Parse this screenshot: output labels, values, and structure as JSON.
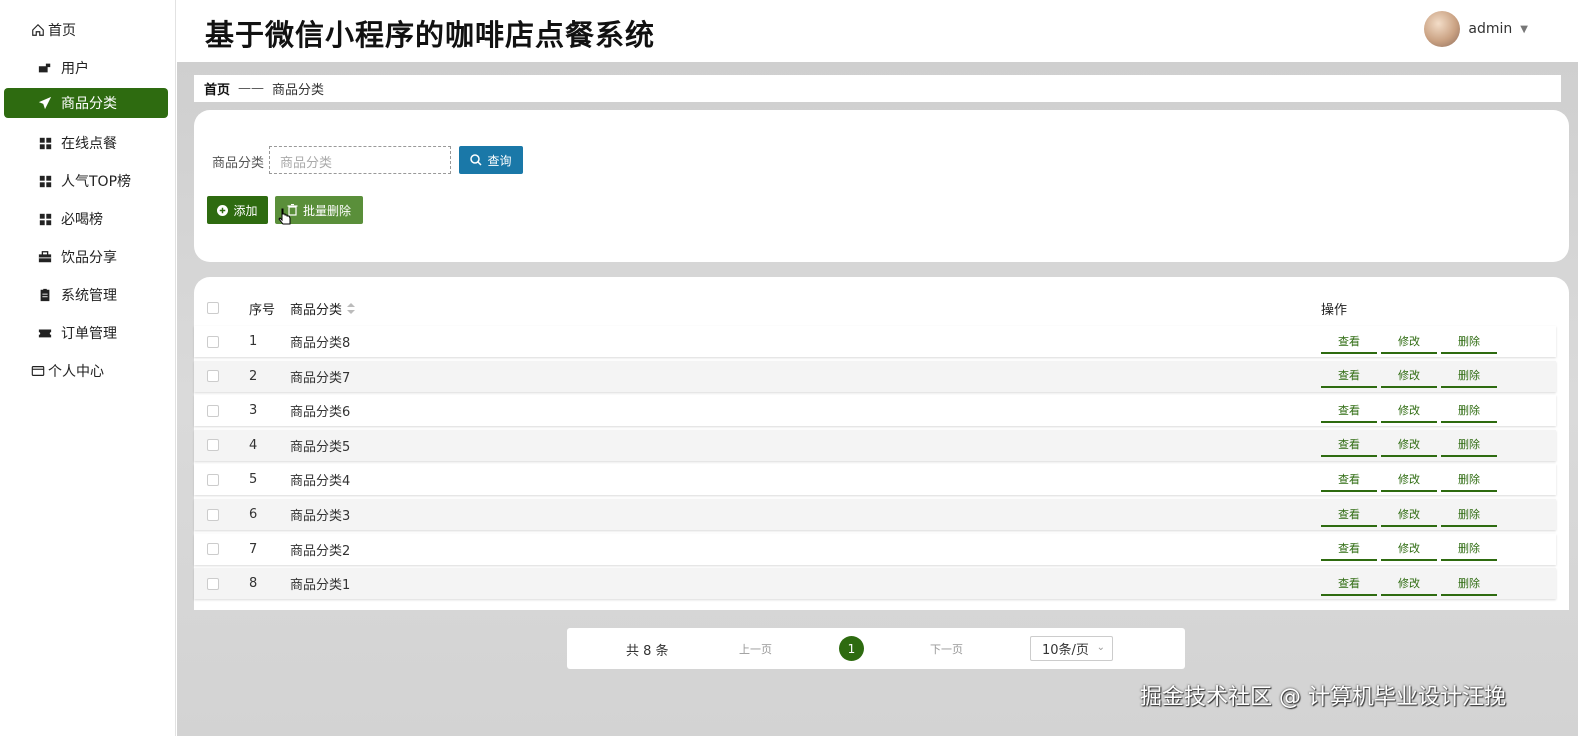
{
  "app": {
    "title": "基于微信小程序的咖啡店点餐系统",
    "user": "admin"
  },
  "sidebar": {
    "items": [
      {
        "label": "首页",
        "icon": "home-icon"
      },
      {
        "label": "用户",
        "icon": "user-icon"
      },
      {
        "label": "商品分类",
        "icon": "send-icon",
        "active": true
      },
      {
        "label": "在线点餐",
        "icon": "grid-icon"
      },
      {
        "label": "人气TOP榜",
        "icon": "grid-icon"
      },
      {
        "label": "必喝榜",
        "icon": "grid-icon"
      },
      {
        "label": "饮品分享",
        "icon": "briefcase-icon"
      },
      {
        "label": "系统管理",
        "icon": "clipboard-icon"
      },
      {
        "label": "订单管理",
        "icon": "ticket-icon"
      },
      {
        "label": "个人中心",
        "icon": "wallet-icon"
      }
    ]
  },
  "breadcrumb": {
    "home": "首页",
    "sep": "——",
    "current": "商品分类"
  },
  "search": {
    "label": "商品分类",
    "placeholder": "商品分类",
    "button": "查询"
  },
  "toolbar": {
    "add": "添加",
    "batch_delete": "批量删除"
  },
  "table": {
    "columns": {
      "index": "序号",
      "name": "商品分类",
      "sort_icon": "sort-icon",
      "actions": "操作"
    },
    "rows": [
      {
        "index": "1",
        "name": "商品分类8"
      },
      {
        "index": "2",
        "name": "商品分类7"
      },
      {
        "index": "3",
        "name": "商品分类6"
      },
      {
        "index": "4",
        "name": "商品分类5"
      },
      {
        "index": "5",
        "name": "商品分类4"
      },
      {
        "index": "6",
        "name": "商品分类3"
      },
      {
        "index": "7",
        "name": "商品分类2"
      },
      {
        "index": "8",
        "name": "商品分类1"
      }
    ],
    "actions": {
      "view": "查看",
      "edit": "修改",
      "delete": "删除"
    }
  },
  "pagination": {
    "total": "共 8 条",
    "prev": "上一页",
    "page": "1",
    "next": "下一页",
    "page_size": "10条/页"
  },
  "watermark": "掘金技术社区 @ 计算机毕业设计汪挽",
  "colors": {
    "primary": "#2e6b10",
    "query": "#1a78a8"
  }
}
